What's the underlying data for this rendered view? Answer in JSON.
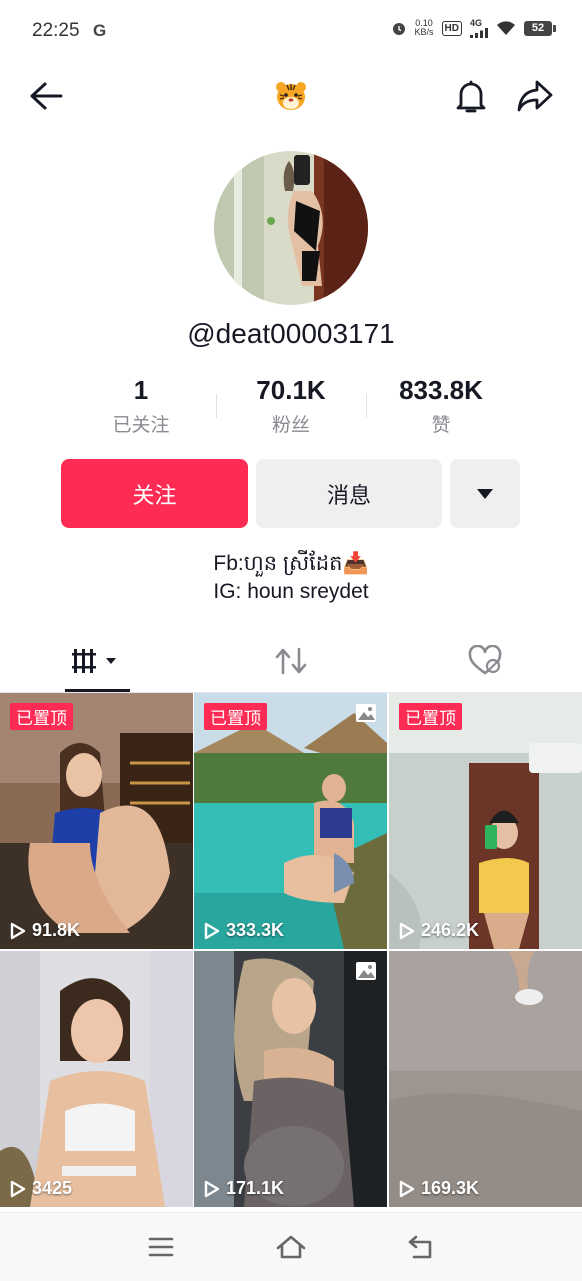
{
  "status_bar": {
    "time": "22:25",
    "g": "G",
    "speed_value": "0.10",
    "speed_unit": "KB/s",
    "hd": "HD",
    "net": "4G",
    "battery": "52"
  },
  "header": {
    "back_icon": "arrow-left-icon",
    "logo_icon": "tiger-emoji",
    "bell_icon": "bell-icon",
    "share_icon": "share-icon"
  },
  "profile": {
    "username": "@deat00003171",
    "stats": [
      {
        "value": "1",
        "label": "已关注"
      },
      {
        "value": "70.1K",
        "label": "粉丝"
      },
      {
        "value": "833.8K",
        "label": "赞"
      }
    ],
    "follow_label": "关注",
    "message_label": "消息",
    "bio_line1": "Fb:ហួន ស្រីដែត📥",
    "bio_line2": "IG: houn sreydet"
  },
  "tabs": [
    {
      "name": "videos",
      "icon": "grid-icon"
    },
    {
      "name": "reposts",
      "icon": "repost-icon"
    },
    {
      "name": "liked",
      "icon": "liked-hidden-icon"
    }
  ],
  "videos": [
    {
      "views": "91.8K",
      "pinned": true,
      "pinned_label": "已置顶",
      "photo": false
    },
    {
      "views": "333.3K",
      "pinned": true,
      "pinned_label": "已置顶",
      "photo": true
    },
    {
      "views": "246.2K",
      "pinned": true,
      "pinned_label": "已置顶",
      "photo": false
    },
    {
      "views": "3425",
      "pinned": false,
      "photo": false
    },
    {
      "views": "171.1K",
      "pinned": false,
      "photo": true
    },
    {
      "views": "169.3K",
      "pinned": false,
      "photo": false
    }
  ],
  "colors": {
    "accent": "#fe2c55",
    "secondary_bg": "#efeff0",
    "text": "#161823",
    "muted": "#8a8b91"
  }
}
